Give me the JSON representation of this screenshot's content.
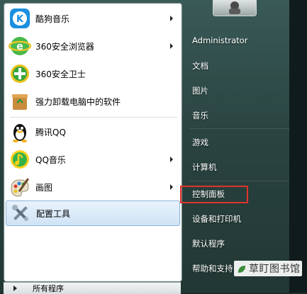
{
  "left_menu": {
    "items": [
      {
        "label": "酷狗音乐",
        "icon": "kugou-icon",
        "has_arrow": true
      },
      {
        "label": "360安全浏览器",
        "icon": "360-browser-icon",
        "has_arrow": true
      },
      {
        "label": "360安全卫士",
        "icon": "360-guard-icon",
        "has_arrow": false
      },
      {
        "label": "强力卸载电脑中的软件",
        "icon": "uninstall-icon",
        "has_arrow": false
      },
      {
        "label": "腾讯QQ",
        "icon": "qq-penguin-icon",
        "has_arrow": false
      },
      {
        "label": "QQ音乐",
        "icon": "qq-music-icon",
        "has_arrow": true
      },
      {
        "label": "画图",
        "icon": "paint-palette-icon",
        "has_arrow": true
      },
      {
        "label": "配置工具",
        "icon": "config-tools-icon",
        "has_arrow": false
      }
    ],
    "all_programs": "所有程序"
  },
  "right_menu": {
    "user": "Administrator",
    "items": [
      "文档",
      "图片",
      "音乐",
      "游戏",
      "计算机",
      "控制面板",
      "设备和打印机",
      "默认程序",
      "帮助和支持"
    ]
  },
  "watermark": {
    "prefix": "草",
    "text": "草盯图书馆"
  },
  "colors": {
    "highlight": "#e0322b",
    "selected_bg": "#cfe3f6"
  }
}
